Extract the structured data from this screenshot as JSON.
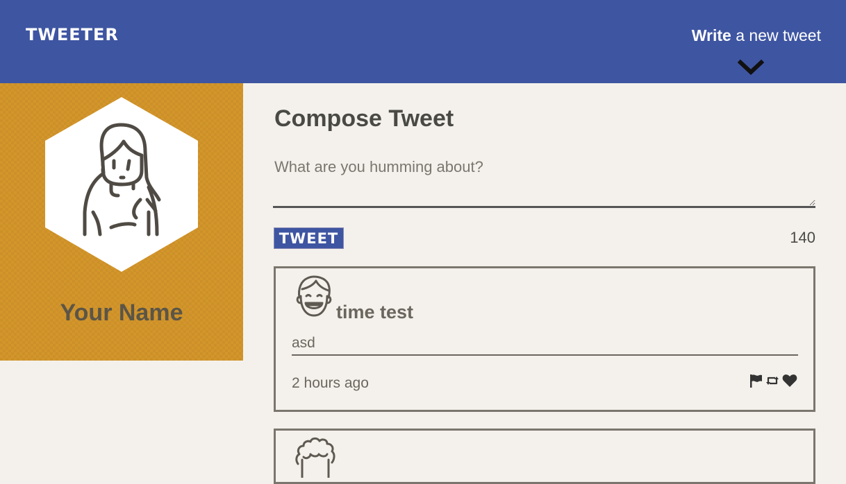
{
  "header": {
    "logo": "TWEETER",
    "write_bold": "Write",
    "write_rest": "a new tweet",
    "toggle_icon": "chevron-down-icon"
  },
  "profile": {
    "name": "Your Name",
    "avatar_icon": "woman-avatar-icon",
    "background_color": "#d4962b"
  },
  "compose": {
    "title": "Compose Tweet",
    "placeholder": "What are you humming about?",
    "value": "",
    "button_label": "TWEET",
    "counter": "140"
  },
  "tweets": [
    {
      "handle": "time test",
      "body": "asd",
      "time": "2 hours ago",
      "avatar_icon": "smiling-man-avatar-icon",
      "actions": [
        "flag-icon",
        "retweet-icon",
        "heart-icon"
      ]
    },
    {
      "avatar_icon": "curly-hair-avatar-icon"
    }
  ],
  "colors": {
    "header": "#3e55a1",
    "profile": "#d4962b",
    "page": "#f4f1ec",
    "text": "#4a4a44"
  }
}
